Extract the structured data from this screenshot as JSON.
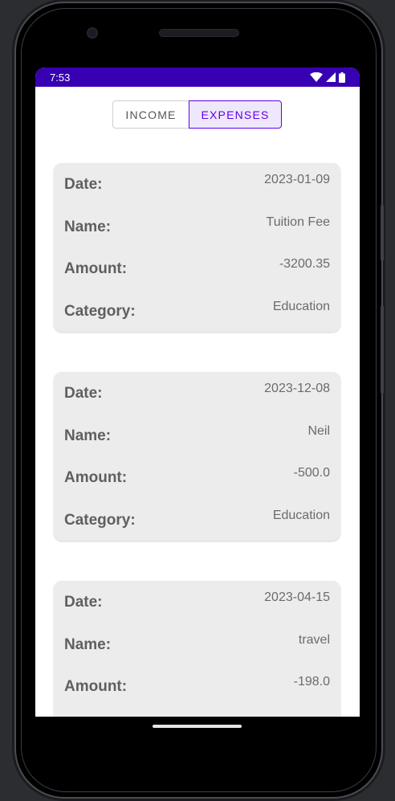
{
  "status_bar": {
    "time": "7:53",
    "background": "#3700b3",
    "icons": [
      "wifi-icon",
      "cellular-signal-icon",
      "battery-icon"
    ]
  },
  "toggle": {
    "income_label": "INCOME",
    "expenses_label": "EXPENSES",
    "selected": "expenses",
    "accent": "#6200ee"
  },
  "labels": {
    "date": "Date:",
    "name": "Name:",
    "amount": "Amount:",
    "category": "Category:"
  },
  "expenses": [
    {
      "date": "2023-01-09",
      "name": "Tuition Fee",
      "amount": "-3200.35",
      "category": "Education"
    },
    {
      "date": "2023-12-08",
      "name": "Neil",
      "amount": "-500.0",
      "category": "Education"
    },
    {
      "date": "2023-04-15",
      "name": "travel",
      "amount": "-198.0"
    }
  ]
}
